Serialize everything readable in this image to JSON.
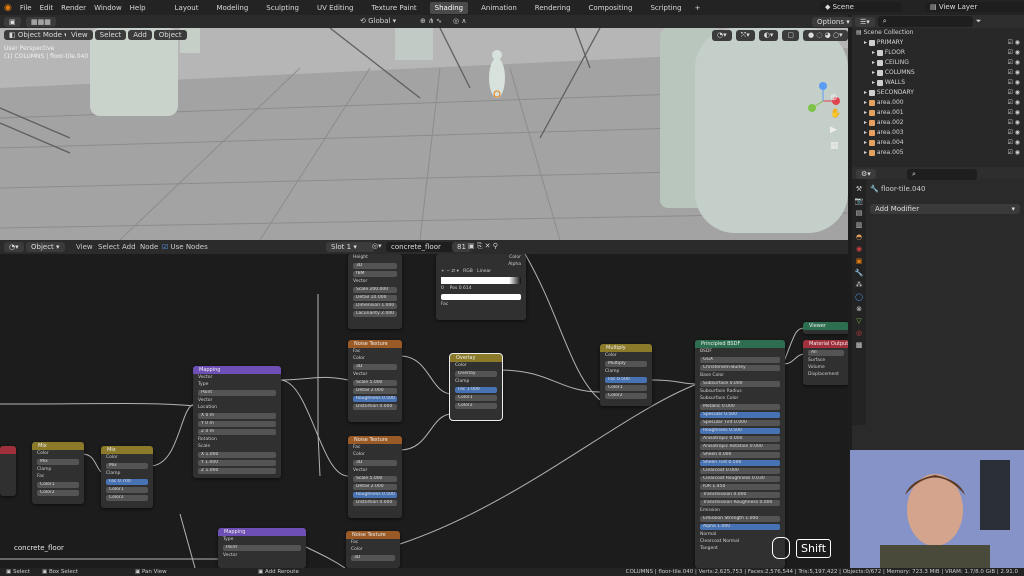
{
  "topbar": {
    "menu": [
      "File",
      "Edit",
      "Render",
      "Window",
      "Help"
    ],
    "workspaces": [
      "Layout",
      "Modeling",
      "Sculpting",
      "UV Editing",
      "Texture Paint",
      "Shading",
      "Animation",
      "Rendering",
      "Compositing",
      "Scripting"
    ],
    "active_workspace": "Shading",
    "plus": "+",
    "scene": "Scene",
    "view_layer": "View Layer"
  },
  "viewport": {
    "mode": "Object Mode",
    "menu": [
      "View",
      "Select",
      "Add",
      "Object"
    ],
    "transform": "Global",
    "options": "Options",
    "overlay_line1": "User Perspective",
    "overlay_line2": "(1) COLUMNS | floor-tile.040"
  },
  "outliner": {
    "title": "Scene Collection",
    "items": [
      {
        "label": "PRIMARY",
        "indent": 1,
        "color": "#e6e6e6"
      },
      {
        "label": "FLOOR",
        "indent": 2,
        "color": "#e6e6e6"
      },
      {
        "label": "CEILING",
        "indent": 2,
        "color": "#e6e6e6"
      },
      {
        "label": "COLUMNS",
        "indent": 2,
        "color": "#e6e6e6"
      },
      {
        "label": "WALLS",
        "indent": 2,
        "color": "#e6e6e6"
      },
      {
        "label": "SECONDARY",
        "indent": 1,
        "color": "#e6e6e6"
      },
      {
        "label": "area.000",
        "indent": 1,
        "color": "#e4a060"
      },
      {
        "label": "area.001",
        "indent": 1,
        "color": "#e4a060"
      },
      {
        "label": "area.002",
        "indent": 1,
        "color": "#e4a060"
      },
      {
        "label": "area.003",
        "indent": 1,
        "color": "#e4a060"
      },
      {
        "label": "area.004",
        "indent": 1,
        "color": "#e4a060"
      },
      {
        "label": "area.005",
        "indent": 1,
        "color": "#e4a060"
      }
    ]
  },
  "properties": {
    "object_name": "floor-tile.040",
    "add_modifier": "Add Modifier"
  },
  "node_editor": {
    "mode": "Object",
    "menu": [
      "View",
      "Select",
      "Add",
      "Node"
    ],
    "use_nodes": "Use Nodes",
    "slot": "Slot 1",
    "material": "concrete_floor",
    "users": "81",
    "frame_label": "concrete_floor",
    "shortcut_hint": "Shift"
  },
  "statusbar": {
    "select": "Select",
    "box_select": "Box Select",
    "pan_view": "Pan View",
    "add_reroute": "Add Reroute",
    "stats": "COLUMNS | floor-tile.040 | Verts:2,625,753 | Faces:2,576,544 | Tris:5,197,422 | Objects:0/672 | Memory: 723.3 MiB | VRAM: 1.7/8.0 GiB | 2.91.0"
  },
  "nodes": {
    "noise_top": {
      "rows": [
        "Height",
        "3D",
        "fBM",
        "Vector",
        "Scale  200.000",
        "Detail  10.000",
        "Dimension  1.000",
        "Lacunarity  2.000"
      ]
    },
    "ramp": {
      "rows": [
        "Color",
        "Alpha",
        "RGB",
        "Linear",
        "0",
        "Pos  0.614",
        "Fac"
      ]
    },
    "mapping_a": {
      "title": "Mapping",
      "rows": [
        "Vector",
        "Type",
        "Point",
        "Vector",
        "Location",
        "X  0 m",
        "Y  0 m",
        "Z  0 m",
        "Rotation",
        "Scale",
        "X  1.000",
        "Y  1.000",
        "Z  1.000"
      ]
    },
    "noise_a": {
      "title": "Noise Texture",
      "rows": [
        "Fac",
        "Color",
        "3D",
        "Vector",
        "Scale  5.000",
        "Detail  2.000",
        "Roughness  0.500",
        "Distortion  0.000"
      ]
    },
    "noise_b": {
      "title": "Noise Texture",
      "rows": [
        "Fac",
        "Color",
        "3D",
        "Vector",
        "Scale  5.000",
        "Detail  2.000",
        "Roughness  0.500",
        "Distortion  0.000"
      ]
    },
    "noise_c": {
      "title": "Noise Texture",
      "rows": [
        "Fac",
        "Color",
        "3D"
      ]
    },
    "overlay": {
      "title": "Overlay",
      "rows": [
        "Color",
        "Overlay",
        "Clamp",
        "Fac  1.000",
        "Color1",
        "Color2"
      ]
    },
    "multiply": {
      "title": "Multiply",
      "rows": [
        "Color",
        "Multiply",
        "Clamp",
        "Fac  0.500",
        "Color1",
        "Color2"
      ]
    },
    "mix_a": {
      "title": "Mix",
      "rows": [
        "Color",
        "Mix",
        "Clamp",
        "Fac",
        "Color1",
        "Color2"
      ]
    },
    "mix_b": {
      "title": "Mix",
      "rows": [
        "Color",
        "Mix",
        "Clamp",
        "Fac  0.700",
        "Color1",
        "Color2"
      ]
    },
    "mapping_b": {
      "title": "Mapping",
      "rows": [
        "Type",
        "Point",
        "Vector"
      ]
    },
    "bsdf": {
      "title": "Principled BSDF",
      "rows": [
        "BSDF",
        "GGX",
        "Christensen-Burley",
        "Base Color",
        "Subsurface  0.000",
        "Subsurface Radius",
        "Subsurface Color",
        "Metallic  0.000",
        "Specular  0.500",
        "Specular Tint  0.000",
        "Roughness  0.500",
        "Anisotropic  0.000",
        "Anisotropic Rotation  0.000",
        "Sheen  0.000",
        "Sheen Tint  0.500",
        "Clearcoat  0.000",
        "Clearcoat Roughness  0.030",
        "IOR  1.450",
        "Transmission  0.000",
        "Transmission Roughness  0.000",
        "Emission",
        "Emission Strength  1.000",
        "Alpha  1.000",
        "Normal",
        "Clearcoat Normal",
        "Tangent"
      ]
    },
    "output": {
      "title": "Material Output",
      "rows": [
        "All",
        "Surface",
        "Volume",
        "Displacement"
      ]
    },
    "viewer": {
      "title": "Viewer"
    }
  }
}
